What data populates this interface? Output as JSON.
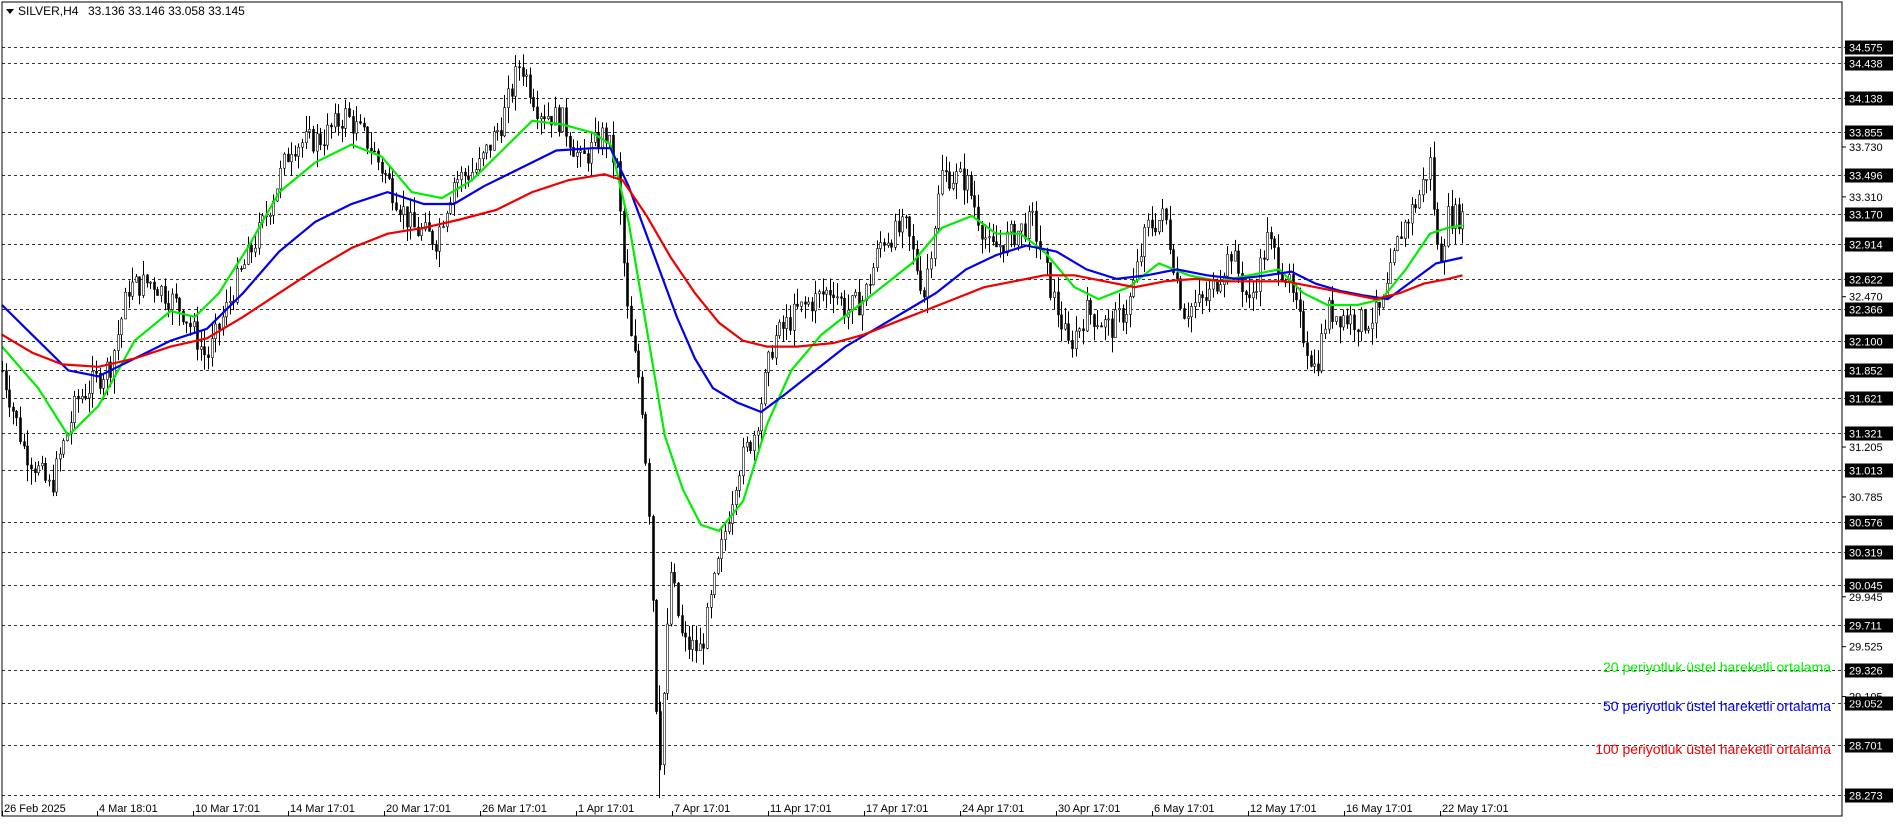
{
  "header": {
    "symbol": "SILVER,H4",
    "ohlc": "33.136 33.146 33.058 33.145"
  },
  "chart_data": {
    "type": "candlestick",
    "title": "SILVER,H4",
    "xlabel": "",
    "ylabel": "",
    "ylim": [
      28.1,
      34.95
    ],
    "grid": false,
    "x_ticks": [
      "26 Feb 2025",
      "4 Mar 18:01",
      "10 Mar 17:01",
      "14 Mar 17:01",
      "20 Mar 17:01",
      "26 Mar 17:01",
      "1 Apr 17:01",
      "7 Apr 17:01",
      "11 Apr 17:01",
      "17 Apr 17:01",
      "24 Apr 17:01",
      "30 Apr 17:01",
      "6 May 17:01",
      "12 May 17:01",
      "16 May 17:01",
      "22 May 17:01"
    ],
    "price_scale_labels": [
      "33.730",
      "33.310",
      "32.470",
      "31.205",
      "30.785",
      "29.945",
      "29.525",
      "29.105"
    ],
    "level_lines": [
      {
        "label": "34.575",
        "value": 34.575
      },
      {
        "label": "34.438",
        "value": 34.438
      },
      {
        "label": "34.138",
        "value": 34.138
      },
      {
        "label": "33.855",
        "value": 33.855
      },
      {
        "label": "33.496",
        "value": 33.496
      },
      {
        "label": "33.170",
        "value": 33.17
      },
      {
        "label": "32.914",
        "value": 32.914
      },
      {
        "label": "32.622",
        "value": 32.622
      },
      {
        "label": "32.366",
        "value": 32.366
      },
      {
        "label": "32.100",
        "value": 32.1
      },
      {
        "label": "31.852",
        "value": 31.852
      },
      {
        "label": "31.621",
        "value": 31.621
      },
      {
        "label": "31.321",
        "value": 31.321
      },
      {
        "label": "31.013",
        "value": 31.013
      },
      {
        "label": "30.576",
        "value": 30.576
      },
      {
        "label": "30.319",
        "value": 30.319
      },
      {
        "label": "30.045",
        "value": 30.045
      },
      {
        "label": "29.711",
        "value": 29.711
      },
      {
        "label": "29.326",
        "value": 29.326
      },
      {
        "label": "29.052",
        "value": 29.052
      },
      {
        "label": "28.701",
        "value": 28.701
      },
      {
        "label": "28.273",
        "value": 28.273
      }
    ],
    "price_path": [
      [
        0,
        31.85
      ],
      [
        18,
        31.2
      ],
      [
        40,
        30.85
      ],
      [
        62,
        31.6
      ],
      [
        90,
        31.9
      ],
      [
        105,
        32.55
      ],
      [
        125,
        32.6
      ],
      [
        150,
        32.35
      ],
      [
        170,
        31.95
      ],
      [
        195,
        32.6
      ],
      [
        215,
        33.05
      ],
      [
        240,
        33.75
      ],
      [
        265,
        33.8
      ],
      [
        285,
        34.0
      ],
      [
        305,
        33.75
      ],
      [
        320,
        33.45
      ],
      [
        340,
        33.05
      ],
      [
        360,
        32.95
      ],
      [
        375,
        33.45
      ],
      [
        395,
        33.55
      ],
      [
        415,
        33.95
      ],
      [
        430,
        34.45
      ],
      [
        445,
        34.05
      ],
      [
        465,
        33.95
      ],
      [
        480,
        33.6
      ],
      [
        500,
        33.85
      ],
      [
        510,
        33.55
      ],
      [
        520,
        32.2
      ],
      [
        530,
        31.7
      ],
      [
        538,
        30.55
      ],
      [
        545,
        28.45
      ],
      [
        555,
        30.15
      ],
      [
        565,
        29.55
      ],
      [
        580,
        29.5
      ],
      [
        595,
        30.25
      ],
      [
        610,
        31.0
      ],
      [
        625,
        31.35
      ],
      [
        640,
        32.1
      ],
      [
        660,
        32.35
      ],
      [
        690,
        32.55
      ],
      [
        700,
        32.35
      ],
      [
        715,
        32.45
      ],
      [
        730,
        32.95
      ],
      [
        750,
        33.05
      ],
      [
        765,
        32.5
      ],
      [
        780,
        33.5
      ],
      [
        800,
        33.45
      ],
      [
        820,
        32.85
      ],
      [
        840,
        33.0
      ],
      [
        855,
        33.1
      ],
      [
        870,
        32.55
      ],
      [
        885,
        32.05
      ],
      [
        900,
        32.35
      ],
      [
        920,
        32.2
      ],
      [
        935,
        32.4
      ],
      [
        950,
        33.05
      ],
      [
        965,
        33.15
      ],
      [
        980,
        32.35
      ],
      [
        1000,
        32.45
      ],
      [
        1020,
        32.85
      ],
      [
        1035,
        32.4
      ],
      [
        1050,
        32.95
      ],
      [
        1065,
        32.65
      ],
      [
        1080,
        32.15
      ],
      [
        1090,
        31.85
      ],
      [
        1100,
        32.35
      ],
      [
        1115,
        32.3
      ],
      [
        1130,
        32.25
      ],
      [
        1145,
        32.35
      ],
      [
        1160,
        33.0
      ],
      [
        1175,
        33.3
      ],
      [
        1185,
        33.6
      ],
      [
        1192,
        32.75
      ],
      [
        1200,
        33.15
      ],
      [
        1212,
        33.15
      ]
    ],
    "series": [
      {
        "name": "20 periyotluk üstel hareketli ortalama",
        "color": "#00ee00",
        "points": [
          [
            0,
            32.05
          ],
          [
            30,
            31.7
          ],
          [
            55,
            31.3
          ],
          [
            80,
            31.55
          ],
          [
            110,
            32.1
          ],
          [
            140,
            32.35
          ],
          [
            160,
            32.3
          ],
          [
            180,
            32.5
          ],
          [
            205,
            32.9
          ],
          [
            230,
            33.35
          ],
          [
            260,
            33.6
          ],
          [
            290,
            33.75
          ],
          [
            315,
            33.65
          ],
          [
            340,
            33.35
          ],
          [
            365,
            33.3
          ],
          [
            390,
            33.45
          ],
          [
            415,
            33.7
          ],
          [
            440,
            33.95
          ],
          [
            465,
            33.92
          ],
          [
            490,
            33.85
          ],
          [
            505,
            33.75
          ],
          [
            520,
            33.1
          ],
          [
            535,
            32.2
          ],
          [
            550,
            31.3
          ],
          [
            565,
            30.85
          ],
          [
            580,
            30.55
          ],
          [
            595,
            30.5
          ],
          [
            615,
            30.75
          ],
          [
            635,
            31.4
          ],
          [
            655,
            31.85
          ],
          [
            680,
            32.15
          ],
          [
            705,
            32.35
          ],
          [
            730,
            32.55
          ],
          [
            755,
            32.75
          ],
          [
            780,
            33.05
          ],
          [
            805,
            33.15
          ],
          [
            825,
            33.0
          ],
          [
            845,
            33.0
          ],
          [
            865,
            32.85
          ],
          [
            890,
            32.55
          ],
          [
            910,
            32.45
          ],
          [
            935,
            32.55
          ],
          [
            960,
            32.75
          ],
          [
            985,
            32.65
          ],
          [
            1010,
            32.6
          ],
          [
            1035,
            32.65
          ],
          [
            1060,
            32.7
          ],
          [
            1080,
            32.5
          ],
          [
            1100,
            32.4
          ],
          [
            1125,
            32.4
          ],
          [
            1145,
            32.45
          ],
          [
            1165,
            32.7
          ],
          [
            1185,
            33.0
          ],
          [
            1200,
            33.05
          ],
          [
            1212,
            33.07
          ]
        ]
      },
      {
        "name": "50 periyotluk üstel hareketli ortalama",
        "color": "#0000ee",
        "points": [
          [
            0,
            32.4
          ],
          [
            30,
            32.1
          ],
          [
            55,
            31.85
          ],
          [
            80,
            31.8
          ],
          [
            110,
            31.95
          ],
          [
            140,
            32.1
          ],
          [
            170,
            32.2
          ],
          [
            200,
            32.5
          ],
          [
            230,
            32.85
          ],
          [
            260,
            33.1
          ],
          [
            290,
            33.25
          ],
          [
            320,
            33.35
          ],
          [
            350,
            33.25
          ],
          [
            375,
            33.25
          ],
          [
            400,
            33.4
          ],
          [
            430,
            33.55
          ],
          [
            460,
            33.7
          ],
          [
            490,
            33.72
          ],
          [
            505,
            33.72
          ],
          [
            520,
            33.4
          ],
          [
            540,
            32.85
          ],
          [
            560,
            32.3
          ],
          [
            575,
            31.95
          ],
          [
            590,
            31.7
          ],
          [
            610,
            31.58
          ],
          [
            630,
            31.5
          ],
          [
            650,
            31.65
          ],
          [
            675,
            31.85
          ],
          [
            700,
            32.05
          ],
          [
            725,
            32.2
          ],
          [
            750,
            32.35
          ],
          [
            775,
            32.5
          ],
          [
            800,
            32.7
          ],
          [
            825,
            32.82
          ],
          [
            850,
            32.9
          ],
          [
            875,
            32.85
          ],
          [
            900,
            32.7
          ],
          [
            925,
            32.62
          ],
          [
            950,
            32.65
          ],
          [
            975,
            32.7
          ],
          [
            1000,
            32.65
          ],
          [
            1025,
            32.62
          ],
          [
            1050,
            32.65
          ],
          [
            1070,
            32.68
          ],
          [
            1090,
            32.58
          ],
          [
            1110,
            32.52
          ],
          [
            1130,
            32.48
          ],
          [
            1150,
            32.45
          ],
          [
            1170,
            32.6
          ],
          [
            1190,
            32.75
          ],
          [
            1212,
            32.8
          ]
        ]
      },
      {
        "name": "100 periyotluk üstel hareketli ortalama",
        "color": "#ee0000",
        "points": [
          [
            0,
            32.15
          ],
          [
            25,
            32.0
          ],
          [
            50,
            31.9
          ],
          [
            80,
            31.88
          ],
          [
            110,
            31.95
          ],
          [
            140,
            32.05
          ],
          [
            170,
            32.12
          ],
          [
            200,
            32.3
          ],
          [
            230,
            32.5
          ],
          [
            260,
            32.7
          ],
          [
            290,
            32.88
          ],
          [
            320,
            33.0
          ],
          [
            350,
            33.05
          ],
          [
            380,
            33.12
          ],
          [
            410,
            33.2
          ],
          [
            440,
            33.35
          ],
          [
            470,
            33.45
          ],
          [
            500,
            33.5
          ],
          [
            515,
            33.45
          ],
          [
            535,
            33.15
          ],
          [
            555,
            32.8
          ],
          [
            575,
            32.5
          ],
          [
            595,
            32.25
          ],
          [
            615,
            32.1
          ],
          [
            635,
            32.05
          ],
          [
            660,
            32.05
          ],
          [
            690,
            32.08
          ],
          [
            715,
            32.15
          ],
          [
            740,
            32.25
          ],
          [
            765,
            32.35
          ],
          [
            790,
            32.45
          ],
          [
            815,
            32.55
          ],
          [
            840,
            32.6
          ],
          [
            865,
            32.65
          ],
          [
            890,
            32.65
          ],
          [
            915,
            32.6
          ],
          [
            940,
            32.55
          ],
          [
            965,
            32.6
          ],
          [
            990,
            32.62
          ],
          [
            1015,
            32.6
          ],
          [
            1040,
            32.6
          ],
          [
            1065,
            32.6
          ],
          [
            1090,
            32.55
          ],
          [
            1115,
            32.5
          ],
          [
            1140,
            32.45
          ],
          [
            1160,
            32.5
          ],
          [
            1180,
            32.58
          ],
          [
            1200,
            32.62
          ],
          [
            1212,
            32.65
          ]
        ]
      }
    ],
    "legend": {
      "placement": "bottom-right",
      "items": [
        {
          "label": "20 periyotluk üstel hareketli ortalama",
          "color": "#00ee00"
        },
        {
          "label": "50 periyotluk üstel hareketli ortalama",
          "color": "#0000ee"
        },
        {
          "label": "100 periyotluk üstel hareketli ortalama",
          "color": "#ee0000"
        }
      ]
    }
  }
}
